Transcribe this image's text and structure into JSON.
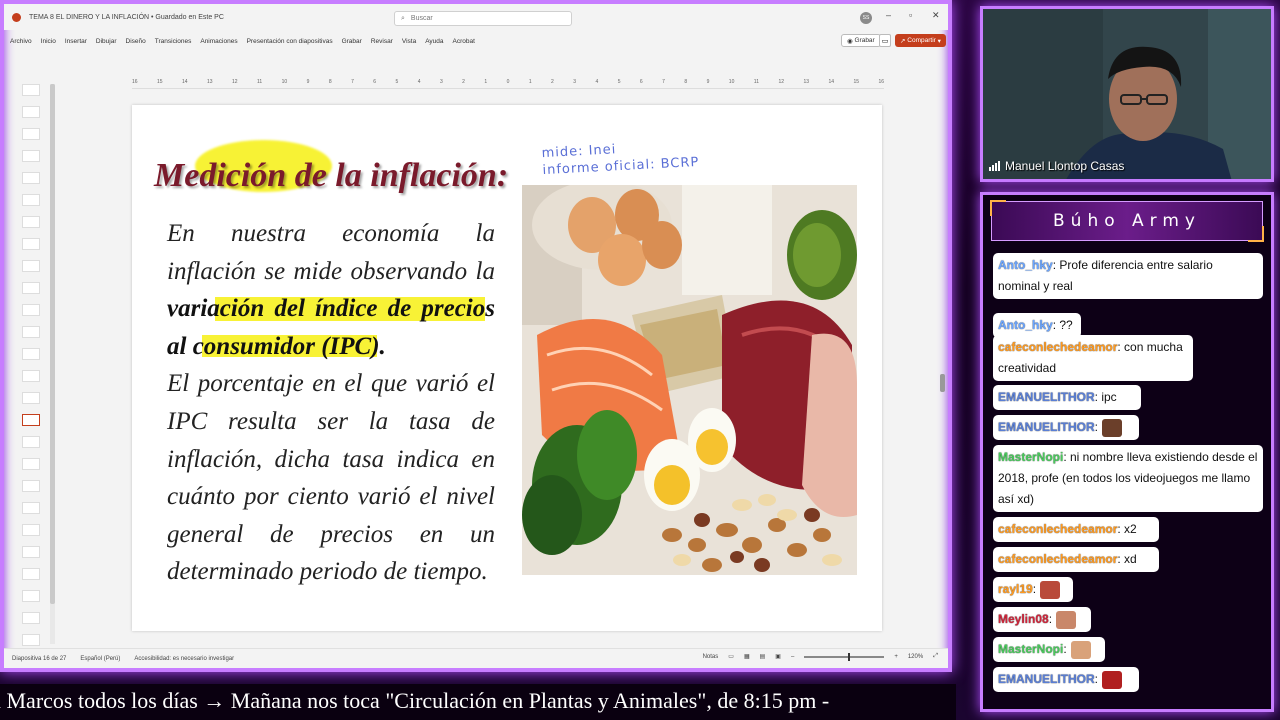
{
  "ppt": {
    "doc_title": "TEMA 8 EL DINERO Y LA INFLACIÓN • Guardado en Este PC",
    "search_placeholder": "Buscar",
    "user_initials": "SS",
    "menu": [
      "Archivo",
      "Inicio",
      "Insertar",
      "Dibujar",
      "Diseño",
      "Transiciones",
      "Animaciones",
      "Presentación con diapositivas",
      "Grabar",
      "Revisar",
      "Vista",
      "Ayuda",
      "Acrobat"
    ],
    "record_label": "Grabar",
    "share_label": "Compartir",
    "ruler_ticks": [
      "16",
      "15",
      "14",
      "13",
      "12",
      "11",
      "10",
      "9",
      "8",
      "7",
      "6",
      "5",
      "4",
      "3",
      "2",
      "1",
      "0",
      "1",
      "2",
      "3",
      "4",
      "5",
      "6",
      "7",
      "8",
      "9",
      "10",
      "11",
      "12",
      "13",
      "14",
      "15",
      "16"
    ],
    "slide": {
      "title": "Medición de la inflación:",
      "body_lines": [
        "En nuestra economía la",
        "inflación se mide observando la",
        "variación del índice de precios",
        "al consumidor (IPC).",
        "El porcentaje en el que varió el",
        "IPC resulta ser la tasa de",
        "inflación, dicha tasa indica en",
        "cuánto por ciento varió el nivel",
        "general de precios en un",
        "determinado periodo de tiempo."
      ],
      "annotation_line1": "mide: Inei",
      "annotation_line2": "informe oficial: BCRP"
    },
    "status": {
      "slide_of": "Diapositiva 16 de 27",
      "language": "Español (Perú)",
      "accessibility": "Accesibilidad: es necesario investigar",
      "notes": "Notas",
      "zoom": "120%"
    }
  },
  "webcam": {
    "name": "Manuel Llontop Casas"
  },
  "chat": {
    "title": "Búho Army",
    "messages": [
      {
        "user": "Anto_hky",
        "text": ": Profe diferencia entre salario nominal y real",
        "color": "#6aa5ff"
      },
      {
        "user": "Anto_hky",
        "text": ": ??",
        "color": "#6aa5ff"
      },
      {
        "user": "cafeconlechedeamor",
        "text": ": con mucha creatividad",
        "color": "#ff9a1f"
      },
      {
        "user": "EMANUELITHOR",
        "text": ": ipc",
        "color": "#5a7fd6"
      },
      {
        "user": "EMANUELITHOR",
        "text": ":",
        "color": "#5a7fd6",
        "emote": "face"
      },
      {
        "user": "MasterNopi",
        "text": ": ni nombre lleva existiendo desde el 2018, profe (en todos los videojuegos me llamo así xd)",
        "color": "#49c95c"
      },
      {
        "user": "cafeconlechedeamor",
        "text": ": x2",
        "color": "#ff9a1f"
      },
      {
        "user": "cafeconlechedeamor",
        "text": ": xd",
        "color": "#ff9a1f"
      },
      {
        "user": "rayl19",
        "text": ":",
        "color": "#ff9a1f",
        "emote": "face"
      },
      {
        "user": "Meylin08",
        "text": ":",
        "color": "#d0243a",
        "emote": "face"
      },
      {
        "user": "MasterNopi",
        "text": ":",
        "color": "#49c95c",
        "emote": "face"
      },
      {
        "user": "EMANUELITHOR",
        "text": ":",
        "color": "#5a7fd6",
        "emote": "face"
      }
    ]
  },
  "ticker": "n Marcos todos los días  →  Mañana nos toca \"Circulación en Plantas y Animales\", de 8:15 pm -"
}
